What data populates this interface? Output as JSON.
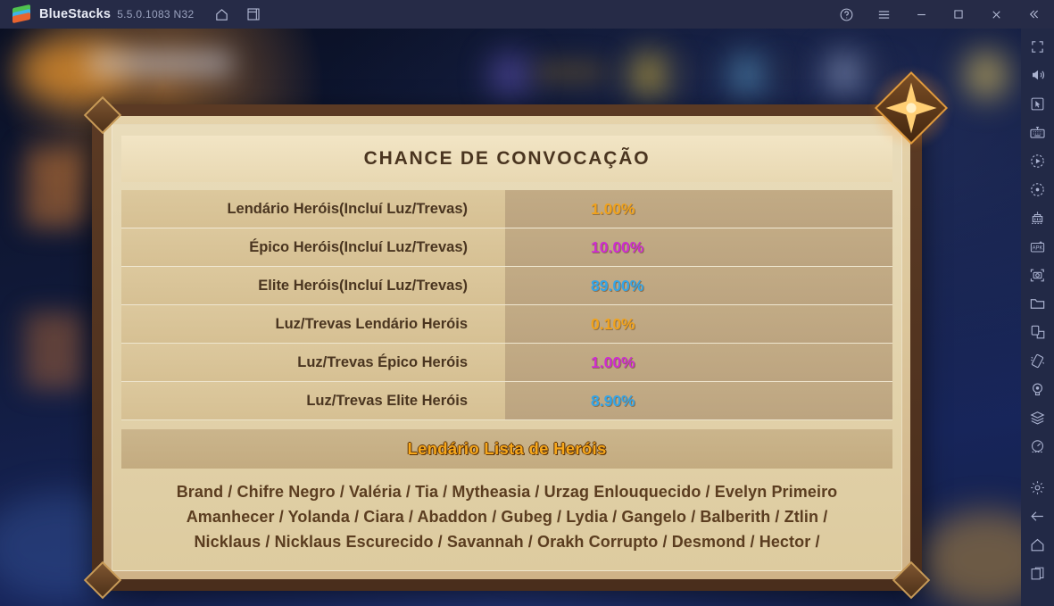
{
  "titlebar": {
    "app_name": "BlueStacks",
    "version": "5.5.0.1083 N32",
    "icons": [
      "home-icon",
      "multi-instance-icon"
    ],
    "right_icons": [
      "help-icon",
      "menu-icon",
      "minimize-icon",
      "maximize-icon",
      "close-icon",
      "collapse-icon"
    ]
  },
  "sidebar": {
    "items": [
      {
        "name": "fullscreen-icon"
      },
      {
        "name": "volume-icon"
      },
      {
        "name": "cursor-icon"
      },
      {
        "name": "keyboard-controls-icon"
      },
      {
        "name": "macro-record-icon"
      },
      {
        "name": "shooting-mode-icon"
      },
      {
        "name": "eco-mode-icon"
      },
      {
        "name": "install-apk-icon"
      },
      {
        "name": "screenshot-icon"
      },
      {
        "name": "media-folder-icon"
      },
      {
        "name": "rotate-screen-icon"
      },
      {
        "name": "shake-icon"
      },
      {
        "name": "location-icon"
      },
      {
        "name": "multi-instance-manager-icon"
      },
      {
        "name": "performance-icon"
      },
      {
        "name": "settings-icon"
      },
      {
        "name": "back-icon"
      },
      {
        "name": "android-home-icon"
      },
      {
        "name": "recent-apps-icon"
      }
    ]
  },
  "dialog": {
    "title": "CHANCE DE CONVOCAÇÃO",
    "star_ornament": "star-ornament-icon",
    "table": {
      "rows": [
        {
          "label": "Lendário Heróis(Incluí Luz/Trevas)",
          "value": "1.00%",
          "color": "#f0a21c"
        },
        {
          "label": "Épico Heróis(Incluí Luz/Trevas)",
          "value": "10.00%",
          "color": "#cf2cd1"
        },
        {
          "label": "Elite Heróis(Incluí Luz/Trevas)",
          "value": "89.00%",
          "color": "#34a5e8"
        },
        {
          "label": "Luz/Trevas Lendário Heróis",
          "value": "0.10%",
          "color": "#f0a21c"
        },
        {
          "label": "Luz/Trevas Épico Heróis",
          "value": "1.00%",
          "color": "#cf2cd1"
        },
        {
          "label": "Luz/Trevas Elite Heróis",
          "value": "8.90%",
          "color": "#34a5e8"
        }
      ]
    },
    "hero_list": {
      "title": "Lendário Lista de Heróis",
      "lines": [
        "Brand / Chifre Negro / Valéria / Tia / Mytheasia / Urzag Enlouquecido / Evelyn Primeiro",
        "Amanhecer / Yolanda / Ciara / Abaddon / Gubeg / Lydia / Gangelo / Balberith / Ztlin /",
        "Nicklaus / Nicklaus Escurecido / Savannah / Orakh Corrupto / Desmond / Hector /"
      ]
    }
  }
}
